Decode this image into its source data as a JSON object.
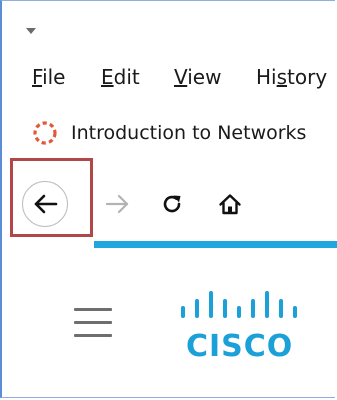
{
  "menubar": {
    "items": [
      {
        "prefix": "",
        "underline": "F",
        "suffix": "ile"
      },
      {
        "prefix": "",
        "underline": "E",
        "suffix": "dit"
      },
      {
        "prefix": "",
        "underline": "V",
        "suffix": "iew"
      },
      {
        "prefix": "Hi",
        "underline": "s",
        "suffix": "tory"
      }
    ]
  },
  "tab": {
    "title": "Introduction to Networks",
    "favicon": "dashed-circle-loading-icon",
    "favicon_color": "#e05a3a"
  },
  "navbar": {
    "back_icon": "arrow-left-icon",
    "forward_icon": "arrow-right-icon",
    "reload_icon": "reload-icon",
    "home_icon": "home-icon"
  },
  "page": {
    "menu_icon": "hamburger-icon",
    "logo_text": "CISCO",
    "logo_color": "#1ba0d7",
    "accent_color": "#20a7e0"
  },
  "annotation": {
    "highlight_color": "#b34747"
  }
}
